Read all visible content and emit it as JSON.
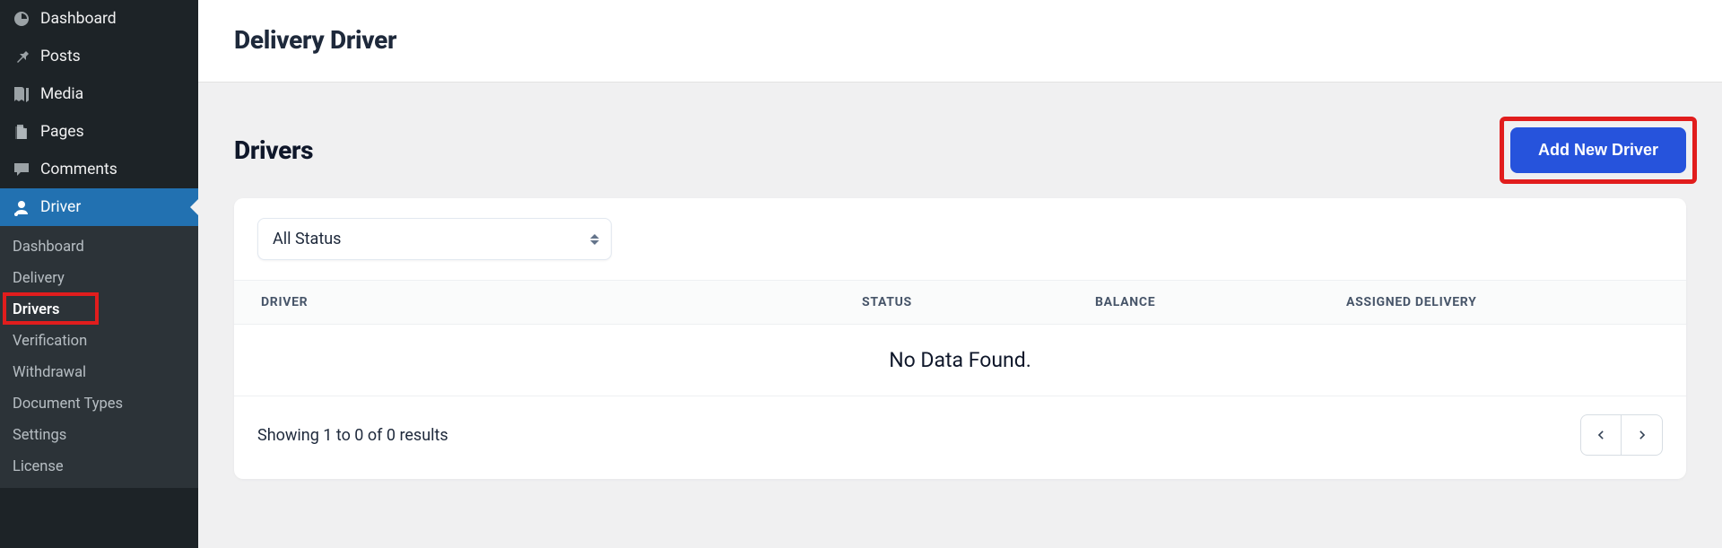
{
  "sidebar": {
    "items": [
      {
        "label": "Dashboard",
        "icon": "dashboard-icon"
      },
      {
        "label": "Posts",
        "icon": "pin-icon"
      },
      {
        "label": "Media",
        "icon": "media-icon"
      },
      {
        "label": "Pages",
        "icon": "pages-icon"
      },
      {
        "label": "Comments",
        "icon": "comments-icon"
      },
      {
        "label": "Driver",
        "icon": "driver-icon",
        "active": true
      }
    ],
    "submenu": [
      {
        "label": "Dashboard"
      },
      {
        "label": "Delivery"
      },
      {
        "label": "Drivers",
        "current": true
      },
      {
        "label": "Verification"
      },
      {
        "label": "Withdrawal"
      },
      {
        "label": "Document Types"
      },
      {
        "label": "Settings"
      },
      {
        "label": "License"
      }
    ]
  },
  "header": {
    "title": "Delivery Driver"
  },
  "section": {
    "title": "Drivers",
    "add_button": "Add New Driver"
  },
  "filter": {
    "status_select": "All Status"
  },
  "table": {
    "columns": {
      "driver": "DRIVER",
      "status": "STATUS",
      "balance": "BALANCE",
      "assigned": "ASSIGNED DELIVERY"
    },
    "empty": "No Data Found."
  },
  "footer": {
    "results_text": "Showing 1 to 0 of 0 results"
  }
}
